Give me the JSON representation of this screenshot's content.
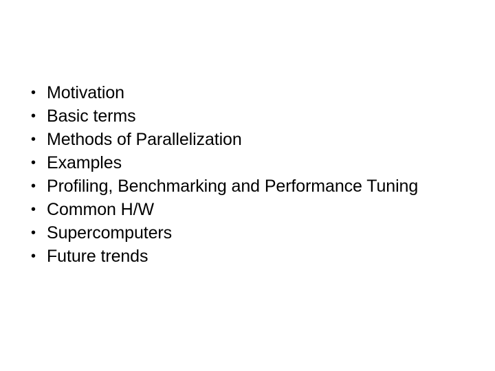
{
  "slide": {
    "background_color": "#ffffff",
    "text_color": "#000000",
    "bullet_glyph": "•",
    "bullet_icon_name": "bullet-dot-icon",
    "items": [
      {
        "label": "Motivation"
      },
      {
        "label": "Basic terms"
      },
      {
        "label": "Methods of Parallelization"
      },
      {
        "label": "Examples"
      },
      {
        "label": "Profiling, Benchmarking and Performance Tuning"
      },
      {
        "label": "Common H/W"
      },
      {
        "label": "Supercomputers"
      },
      {
        "label": "Future trends"
      }
    ]
  }
}
